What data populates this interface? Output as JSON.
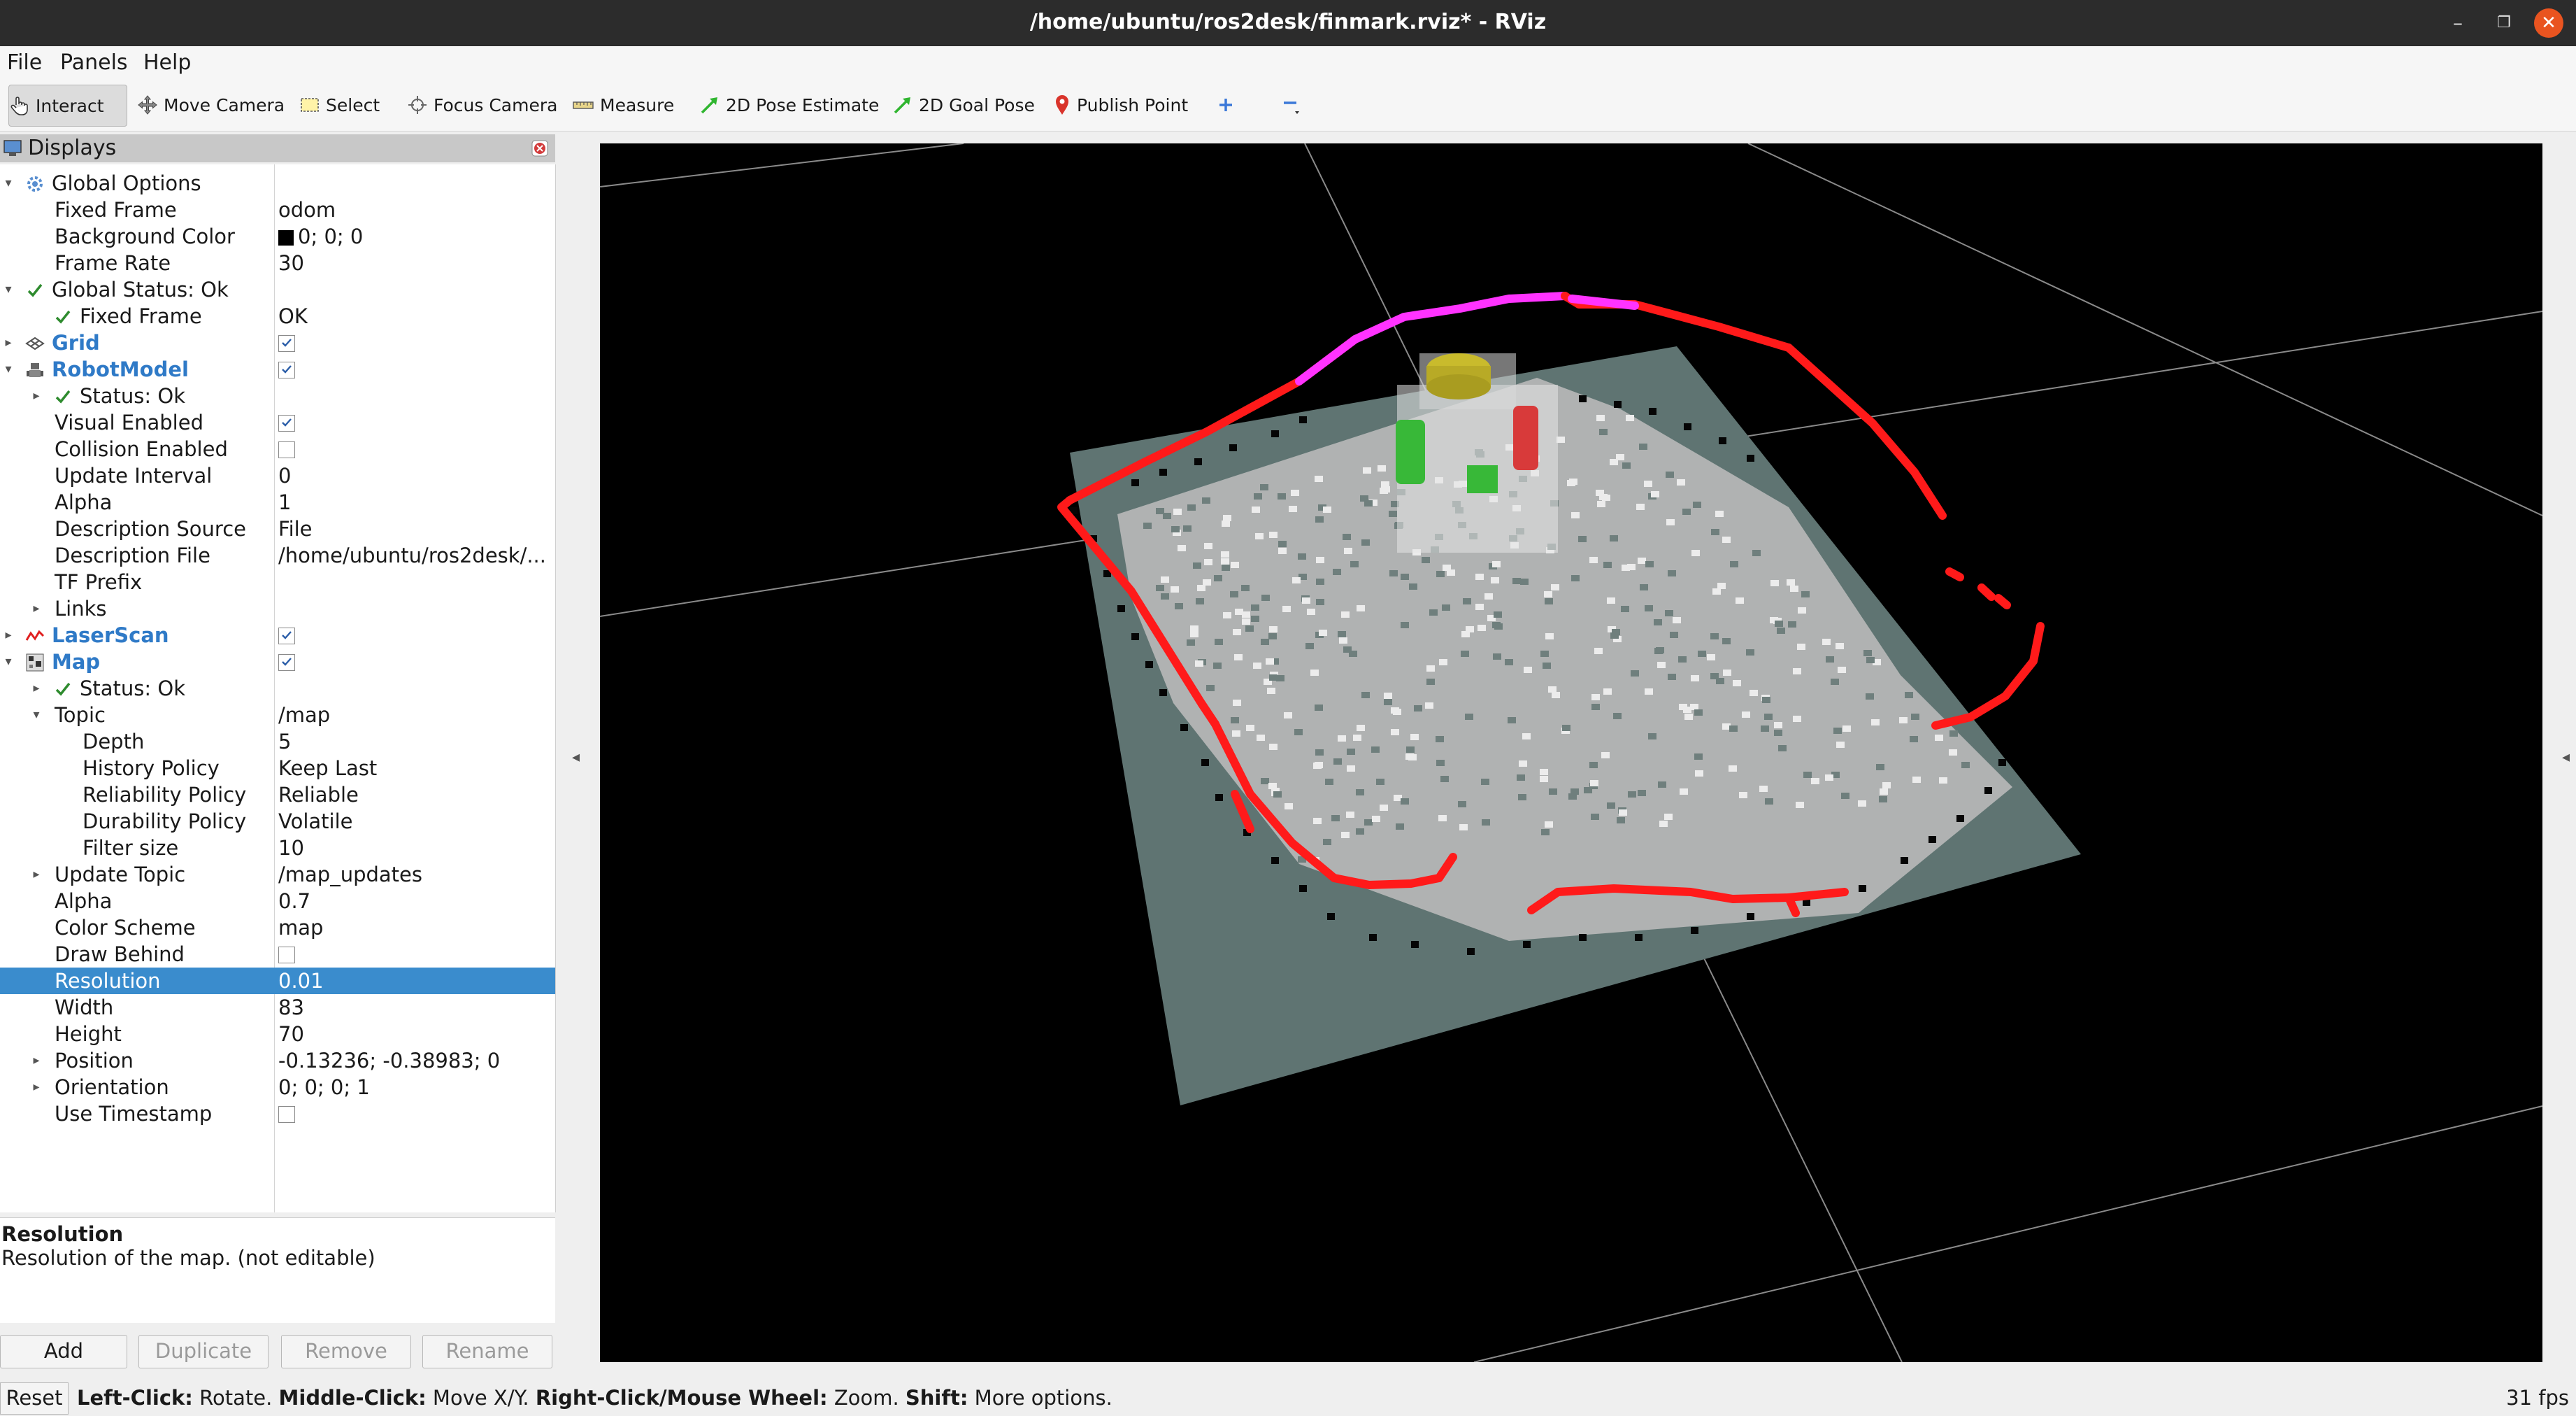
{
  "window": {
    "title": "/home/ubuntu/ros2desk/finmark.rviz* - RViz",
    "controls": [
      "minimize-icon",
      "maximize-icon",
      "close-icon"
    ]
  },
  "menu": [
    "File",
    "Panels",
    "Help"
  ],
  "toolbar": [
    {
      "label": "Interact",
      "icon": "hand-pointer-icon",
      "active": true
    },
    {
      "label": "Move Camera",
      "icon": "move-camera-icon"
    },
    {
      "label": "Select",
      "icon": "select-rectangle-icon"
    },
    {
      "label": "Focus Camera",
      "icon": "focus-camera-icon"
    },
    {
      "label": "Measure",
      "icon": "ruler-icon"
    },
    {
      "label": "2D Pose Estimate",
      "icon": "green-arrow-icon"
    },
    {
      "label": "2D Goal Pose",
      "icon": "green-arrow-icon"
    },
    {
      "label": "Publish Point",
      "icon": "map-pin-icon"
    },
    {
      "label": "",
      "icon": "plus-icon"
    },
    {
      "label": "",
      "icon": "minus-icon"
    }
  ],
  "displays_panel": {
    "title": "Displays",
    "rows": [
      {
        "label": "Global Options",
        "value": "",
        "indent": 0,
        "expand": "open",
        "icon": "gear-icon"
      },
      {
        "label": "Fixed Frame",
        "value": "odom",
        "indent": 1
      },
      {
        "label": "Background Color",
        "value": "0; 0; 0",
        "indent": 1,
        "swatch": "#000000"
      },
      {
        "label": "Frame Rate",
        "value": "30",
        "indent": 1
      },
      {
        "label": "Global Status: Ok",
        "value": "",
        "indent": 0,
        "expand": "open",
        "icon": "check-icon"
      },
      {
        "label": "Fixed Frame",
        "value": "OK",
        "indent": 1,
        "icon": "check-icon"
      },
      {
        "label": "Grid",
        "value": "",
        "indent": 0,
        "expand": "closed",
        "icon": "grid-icon",
        "blue": true,
        "checkbox": true
      },
      {
        "label": "RobotModel",
        "value": "",
        "indent": 0,
        "expand": "open",
        "icon": "robot-icon",
        "blue": true,
        "checkbox": true
      },
      {
        "label": "Status: Ok",
        "value": "",
        "indent": 1,
        "expand": "closed",
        "icon": "check-icon"
      },
      {
        "label": "Visual Enabled",
        "value": "",
        "indent": 1,
        "checkbox": true
      },
      {
        "label": "Collision Enabled",
        "value": "",
        "indent": 1,
        "checkbox": false
      },
      {
        "label": "Update Interval",
        "value": "0",
        "indent": 1
      },
      {
        "label": "Alpha",
        "value": "1",
        "indent": 1
      },
      {
        "label": "Description Source",
        "value": "File",
        "indent": 1
      },
      {
        "label": "Description File",
        "value": "/home/ubuntu/ros2desk/...",
        "indent": 1
      },
      {
        "label": "TF Prefix",
        "value": "",
        "indent": 1
      },
      {
        "label": "Links",
        "value": "",
        "indent": 1,
        "expand": "closed"
      },
      {
        "label": "LaserScan",
        "value": "",
        "indent": 0,
        "expand": "closed",
        "icon": "laser-scan-icon",
        "blue": true,
        "checkbox": true
      },
      {
        "label": "Map",
        "value": "",
        "indent": 0,
        "expand": "open",
        "icon": "map-icon",
        "blue": true,
        "checkbox": true
      },
      {
        "label": "Status: Ok",
        "value": "",
        "indent": 1,
        "expand": "closed",
        "icon": "check-icon"
      },
      {
        "label": "Topic",
        "value": "/map",
        "indent": 1,
        "expand": "open"
      },
      {
        "label": "Depth",
        "value": "5",
        "indent": 2
      },
      {
        "label": "History Policy",
        "value": "Keep Last",
        "indent": 2
      },
      {
        "label": "Reliability Policy",
        "value": "Reliable",
        "indent": 2
      },
      {
        "label": "Durability Policy",
        "value": "Volatile",
        "indent": 2
      },
      {
        "label": "Filter size",
        "value": "10",
        "indent": 2
      },
      {
        "label": "Update Topic",
        "value": "/map_updates",
        "indent": 1,
        "expand": "closed"
      },
      {
        "label": "Alpha",
        "value": "0.7",
        "indent": 1
      },
      {
        "label": "Color Scheme",
        "value": "map",
        "indent": 1
      },
      {
        "label": "Draw Behind",
        "value": "",
        "indent": 1,
        "checkbox": false
      },
      {
        "label": "Resolution",
        "value": "0.01",
        "indent": 1,
        "selected": true
      },
      {
        "label": "Width",
        "value": "83",
        "indent": 1
      },
      {
        "label": "Height",
        "value": "70",
        "indent": 1
      },
      {
        "label": "Position",
        "value": "-0.13236; -0.38983; 0",
        "indent": 1,
        "expand": "closed"
      },
      {
        "label": "Orientation",
        "value": "0; 0; 0; 1",
        "indent": 1,
        "expand": "closed"
      },
      {
        "label": "Use Timestamp",
        "value": "",
        "indent": 1,
        "checkbox": false
      }
    ]
  },
  "description": {
    "title": "Resolution",
    "text": "Resolution of the map. (not editable)"
  },
  "buttons": {
    "add": "Add",
    "duplicate": "Duplicate",
    "remove": "Remove",
    "rename": "Rename"
  },
  "statusbar": {
    "reset": "Reset",
    "hints": [
      {
        "key": "Left-Click:",
        "text": " Rotate. "
      },
      {
        "key": "Middle-Click:",
        "text": " Move X/Y. "
      },
      {
        "key": "Right-Click/Mouse Wheel:",
        "text": " Zoom. "
      },
      {
        "key": "Shift:",
        "text": " More options."
      }
    ],
    "fps": "31 fps"
  },
  "colors": {
    "selection": "#3a8ccd",
    "display_name_blue": "#2f7ac7",
    "laser_red": "#ff1a1a",
    "laser_magenta": "#ff33ff",
    "map_plane": "#5e7371",
    "viewport_bg": "#000000"
  }
}
